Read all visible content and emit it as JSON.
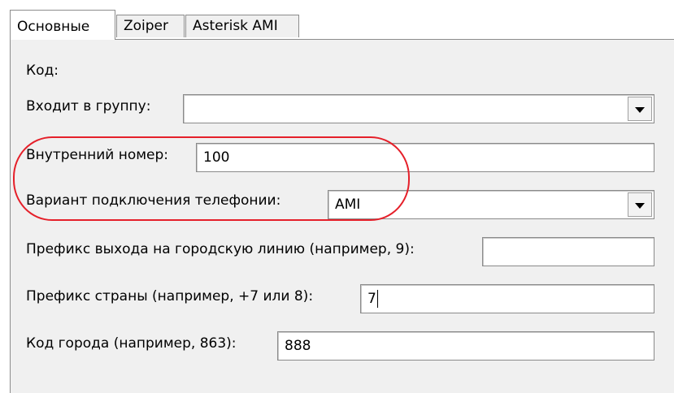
{
  "tabs": [
    {
      "label": "Основные",
      "active": true
    },
    {
      "label": "Zoiper",
      "active": false
    },
    {
      "label": "Asterisk AMI",
      "active": false
    }
  ],
  "form": {
    "code_label": "Код:",
    "group_label": "Входит в группу:",
    "group_value": "",
    "internal_number_label": "Внутренний номер:",
    "internal_number_value": "100",
    "connection_variant_label": "Вариант подключения телефонии:",
    "connection_variant_value": "AMI",
    "exit_prefix_label": "Префикс выхода на городскую линию (например, 9):",
    "exit_prefix_value": "",
    "country_prefix_label": "Префикс страны (например, +7 или 8):",
    "country_prefix_value": "7",
    "city_code_label": "Код города (например, 863):",
    "city_code_value": "888"
  },
  "annotation": {
    "color": "#e5202a",
    "shape": "rounded-rect"
  }
}
